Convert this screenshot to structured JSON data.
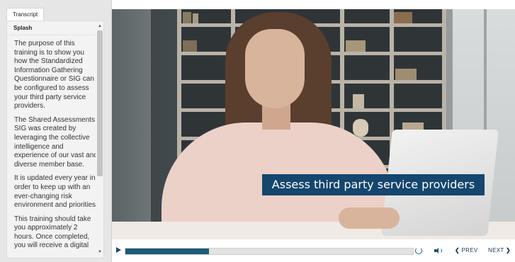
{
  "transcript": {
    "tab_label": "Transcript",
    "section_title": "Splash",
    "paragraphs": [
      "The purpose of this training is to show you how the Standardized Information Gathering Questionnaire or SIG can be configured to assess your third party service providers.",
      "The Shared Assessments SIG was created by leveraging the collective intelligence and experience of our vast and diverse member base.",
      "It is updated every year in order to keep up with an ever-changing risk environment and priorities.",
      "This training should take you approximately 2 hours. Once completed, you will receive a digital"
    ],
    "scroll_up_glyph": "▲",
    "scroll_down_glyph": "▼"
  },
  "video": {
    "caption": "Assess third party service providers",
    "colors": {
      "caption_bg": "#14466e"
    }
  },
  "player": {
    "play_icon": "play-icon",
    "progress_fraction": 0.29,
    "replay_icon": "replay-icon",
    "volume_icon": "volume-icon",
    "prev_label": "PREV",
    "next_label": "NEXT",
    "prev_chevron": "❮",
    "next_chevron": "❯",
    "colors": {
      "accent": "#1d5b78",
      "nav_text": "#1a3a56"
    }
  }
}
